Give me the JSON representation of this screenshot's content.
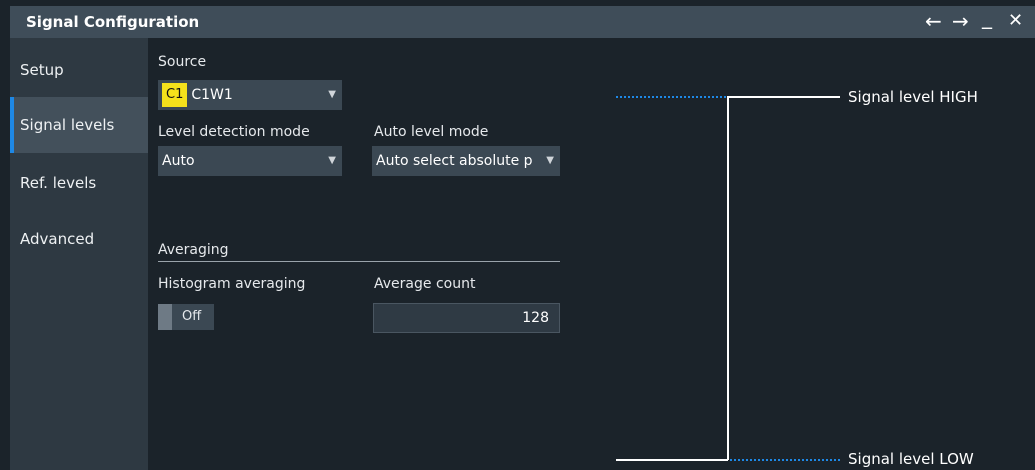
{
  "window": {
    "title": "Signal Configuration",
    "controls": {
      "back_icon": "←",
      "forward_icon": "→",
      "minimize_icon": "_",
      "close_icon": "✕"
    }
  },
  "sidebar": {
    "items": [
      {
        "label": "Setup",
        "active": false
      },
      {
        "label": "Signal levels",
        "active": true
      },
      {
        "label": "Ref. levels",
        "active": false
      },
      {
        "label": "Advanced",
        "active": false
      }
    ]
  },
  "source": {
    "label": "Source",
    "chip": "C1",
    "value": "C1W1"
  },
  "level_detection": {
    "label": "Level detection mode",
    "value": "Auto"
  },
  "auto_level": {
    "label": "Auto level mode",
    "value": "Auto select absolute p"
  },
  "averaging": {
    "section_title": "Averaging",
    "histogram_label": "Histogram averaging",
    "histogram_toggle": "Off",
    "count_label": "Average count",
    "count_value": "128"
  },
  "diagram": {
    "high_label": "Signal level HIGH",
    "low_label": "Signal level LOW"
  },
  "colors": {
    "accent": "#1e88e5",
    "chip": "#f5e11b",
    "background": "#1b232a",
    "sidebar": "#2e3942",
    "titlebar": "#3f4d59"
  }
}
